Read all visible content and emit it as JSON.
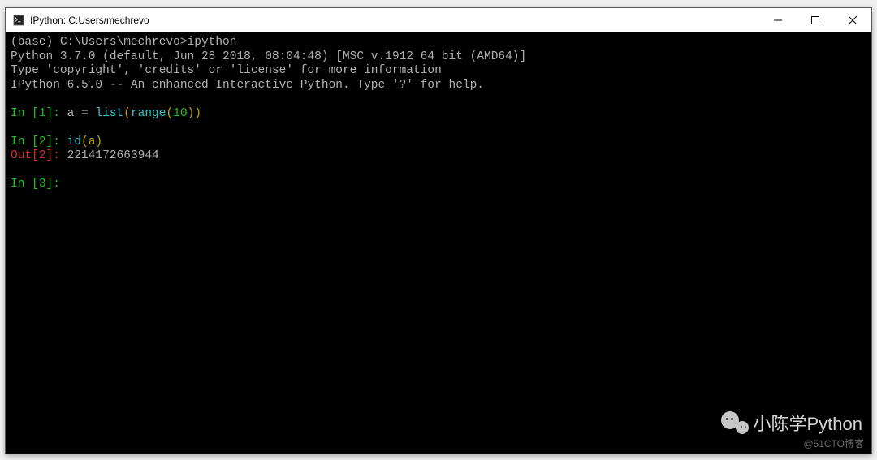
{
  "titlebar": {
    "title": "IPython: C:Users/mechrevo"
  },
  "terminal": {
    "path_prefix": "(base) C:\\Users\\mechrevo>",
    "command": "ipython",
    "header_line1_a": "Python 3.7.0 (default, Jun 28 2018, 08:04:48) ",
    "header_line1_b": "[MSC v.1912 64 bit (AMD64)]",
    "header_line2": "Type 'copyright', 'credits' or 'license' for more information",
    "header_line3": "IPython 6.5.0 -- An enhanced Interactive Python. Type '?' for help.",
    "in1_label": "In [",
    "in1_num": "1",
    "in1_close": "]: ",
    "in1_code_a": "a = ",
    "in1_code_b": "list",
    "in1_code_c": "(",
    "in1_code_d": "range",
    "in1_code_e": "(",
    "in1_code_f": "10",
    "in1_code_g": "))",
    "in2_label": "In [",
    "in2_num": "2",
    "in2_close": "]: ",
    "in2_code_a": "id",
    "in2_code_b": "(a)",
    "out2_label": "Out[",
    "out2_num": "2",
    "out2_close": "]: ",
    "out2_value": "2214172663944",
    "in3_label": "In [",
    "in3_num": "3",
    "in3_close": "]: "
  },
  "watermark": {
    "brand": "小陈学Python",
    "credit": "@51CTO博客"
  }
}
